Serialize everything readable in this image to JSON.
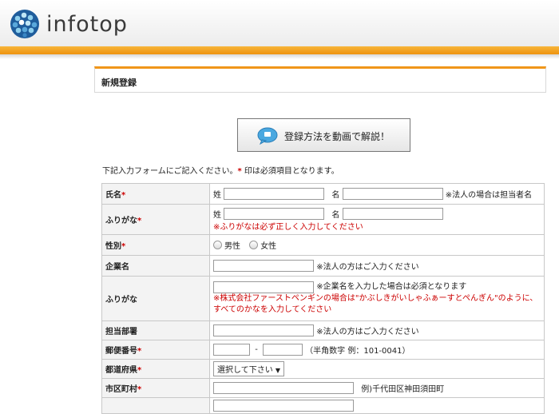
{
  "brand": {
    "name": "infotop"
  },
  "page": {
    "title": "新規登録"
  },
  "video_button": {
    "label": "登録方法を動画で解説！"
  },
  "notice": {
    "text": "下記入力フォームにご記入ください。",
    "required_mark": "*",
    "text2": " 印は必須項目となります。"
  },
  "form": {
    "name": {
      "label": "氏名",
      "req": "*",
      "last": "姓",
      "first": "名",
      "note": "※法人の場合は担当者名"
    },
    "furigana": {
      "label": "ふりがな",
      "req": "*",
      "last": "姓",
      "first": "名",
      "warning": "※ふりがなは必ず正しく入力してください"
    },
    "gender": {
      "label": "性別",
      "req": "*",
      "male": "男性",
      "female": "女性"
    },
    "company": {
      "label": "企業名",
      "note": "※法人の方はご入力ください"
    },
    "company_furigana": {
      "label": "ふりがな",
      "note": "※企業名を入力した場合は必須となります",
      "warning": "※株式会社ファーストペンギンの場合は\"かぶしきがいしゃふぁーすとぺんぎん\"のように、すべてのかなを入力してください"
    },
    "department": {
      "label": "担当部署",
      "note": "※法人の方はご入力ください"
    },
    "postal": {
      "label": "郵便番号",
      "req": "*",
      "dash": "-",
      "note": "（半角数字 例：101-0041）"
    },
    "prefecture": {
      "label": "都道府県",
      "req": "*",
      "selected": "選択して下さい",
      "arrow": "▼"
    },
    "city": {
      "label": "市区町村",
      "req": "*",
      "example": "例)千代田区神田須田町"
    }
  },
  "colors": {
    "accent": "#f0961a",
    "required": "#cc0000"
  }
}
